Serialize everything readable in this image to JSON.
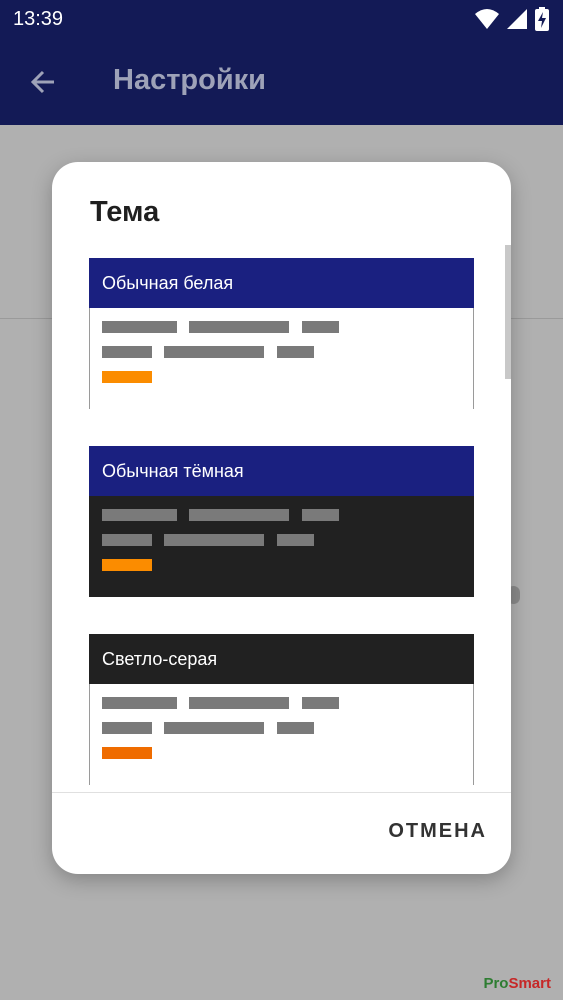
{
  "status": {
    "time": "13:39",
    "icons": [
      "wifi-icon",
      "signal-icon",
      "battery-charging-icon"
    ]
  },
  "appbar": {
    "title": "Настройки",
    "back_icon": "arrow-left-icon"
  },
  "dialog": {
    "title": "Тема",
    "themes": [
      {
        "label": "Обычная белая",
        "header_color": "#1a2080",
        "header_text_color": "#ffffff",
        "body_color": "#ffffff",
        "accent_color": "#fb8c00"
      },
      {
        "label": "Обычная тёмная",
        "header_color": "#1a2080",
        "header_text_color": "#ffffff",
        "body_color": "#212121",
        "accent_color": "#fb8c00"
      },
      {
        "label": "Светло-серая",
        "header_color": "#212121",
        "header_text_color": "#ffffff",
        "body_color": "#ffffff",
        "accent_color": "#ef6c00"
      }
    ],
    "cancel_label": "ОТМЕНА"
  },
  "watermark": {
    "text_pro": "Pro",
    "text_smart": "Smart"
  },
  "colors": {
    "primary_dark": "#131a56",
    "scrim": "#b0b0b0"
  }
}
